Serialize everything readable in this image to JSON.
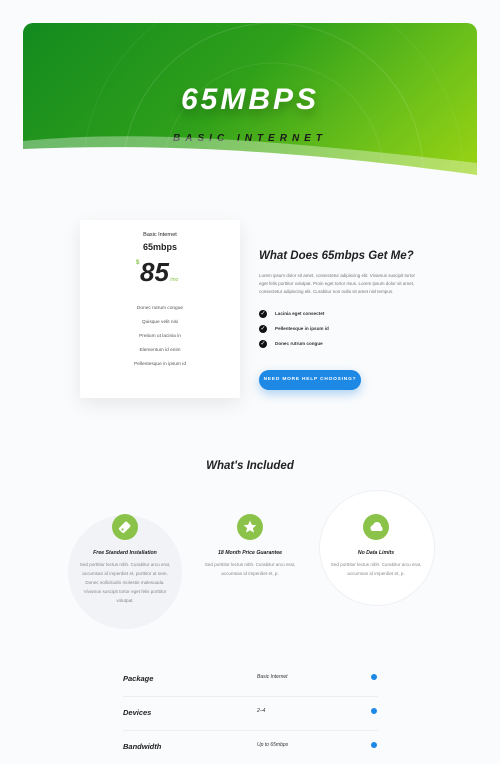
{
  "hero": {
    "title": "65MBPS",
    "subtitle": "BASIC INTERNET"
  },
  "plan_card": {
    "name": "Basic Internet",
    "speed": "65mbps",
    "currency": "$",
    "price": "85",
    "period": "/mo",
    "items": [
      "Donec rutrum congue",
      "Quisque velit nisi",
      "Pretium ut lacinia in",
      "Elementum id enim",
      "Pellentesque in ipsum id"
    ]
  },
  "info": {
    "heading": "What Does 65mbps Get Me?",
    "paragraph": "Lorem ipsum dolor sit amet, consectetur adipiscing elit. Vivamus suscipit tortor eget felis porttitor volutpat. Proin eget tortor risus. Lorem ipsum dolor sit amet, consectetur adipiscing elit. Curabitur non nulla sit amet nisl tempus.",
    "checks": [
      "Lacinia eget consectet",
      "Pellentesque in ipsum id",
      "Donec rutrum congue"
    ],
    "button": "NEED MORE HELP CHOOSING?"
  },
  "included": {
    "title": "What's Included",
    "features": [
      {
        "icon": "tag-icon",
        "title": "Free Standard Installation",
        "desc": "Sed porttitor lectus nibh. Curabitur arcu erat, accumsan id imperdiet et, porttitor at sem. Donec sollicitudin molestie malesuada. Vivamus suscipit tortor eget felis porttitor volutpat."
      },
      {
        "icon": "star-icon",
        "title": "18 Month Price Guarantee",
        "desc": "Sed porttitor lectus nibh. Curabitur arcu erat, accumsan id imperdiet et, p."
      },
      {
        "icon": "cloud-icon",
        "title": "No Data Limits",
        "desc": "Sed porttitor lectus nibh. Curabitur arcu erat, accumsan id imperdiet et, p."
      }
    ]
  },
  "specs": [
    {
      "label": "Package",
      "value": "Basic Internet"
    },
    {
      "label": "Devices",
      "value": "2–4"
    },
    {
      "label": "Bandwidth",
      "value": "Up to 65mbps"
    }
  ],
  "colors": {
    "accent_green": "#8bc34a",
    "accent_blue": "#1e88e5"
  }
}
